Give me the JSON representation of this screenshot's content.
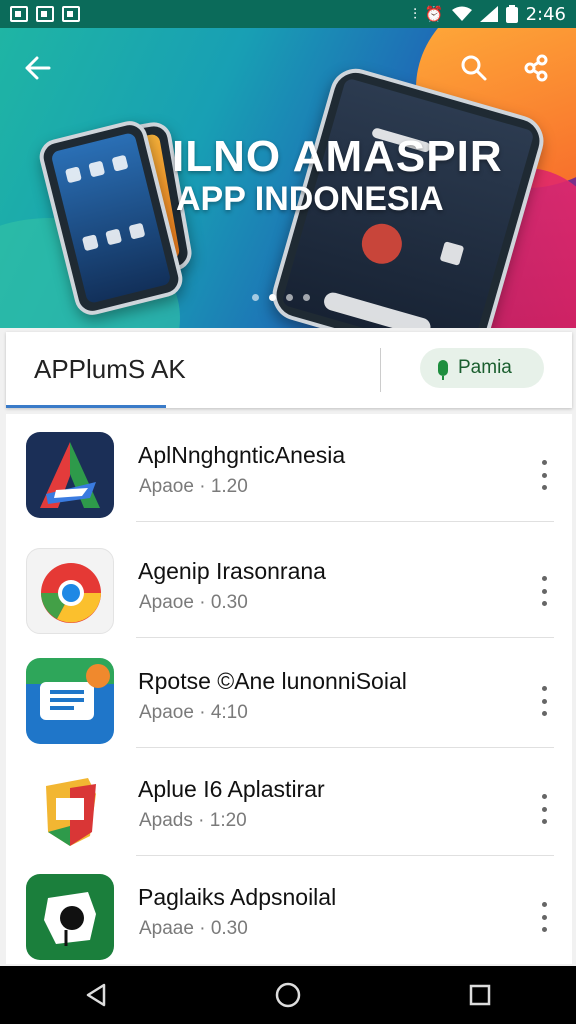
{
  "status_bar": {
    "time": "2:46",
    "left_icons": [
      "image-icon",
      "image-icon",
      "camera-icon"
    ],
    "right_icons": [
      "vibrate-icon",
      "alarm-icon",
      "wifi-icon",
      "signal-icon",
      "battery-icon"
    ]
  },
  "hero": {
    "title": "ILNO AMASPIR",
    "subtitle": "APP INDONESIA",
    "back_icon": "arrow-left-icon",
    "search_icon": "search-icon",
    "share_icon": "share-icon",
    "slide_count": 4,
    "active_slide": 1,
    "colors": {
      "teal": "#1fb5a4",
      "blue": "#1e6fb6",
      "orange": "#f7692a",
      "pink": "#c51d5a"
    }
  },
  "tabs": {
    "label": "APPlumS AK",
    "chip_label": "Pamia",
    "chip_icon": "mic-icon",
    "accent": "#3a7bc8"
  },
  "apps": [
    {
      "name": "AplNnghgnticAnesia",
      "meta": "Apaoe · 1.20",
      "icon": "a-logo-icon"
    },
    {
      "name": "Agenip Irasonrana",
      "meta": "Apaoe · 0.30",
      "icon": "chrome-icon"
    },
    {
      "name": "Rpotse ©Ane lunonniSoial",
      "meta": "Apaoe · 4:10",
      "icon": "messages-icon"
    },
    {
      "name": "Aplue I6 Aplastirar",
      "meta": "Apads · 1:20",
      "icon": "map-icon"
    },
    {
      "name": "Paglaiks Adpsnoilal",
      "meta": "Apaae · 0.30",
      "icon": "puzzle-icon"
    }
  ],
  "nav": {
    "back_icon": "nav-back-icon",
    "home_icon": "nav-home-icon",
    "recents_icon": "nav-recents-icon"
  }
}
